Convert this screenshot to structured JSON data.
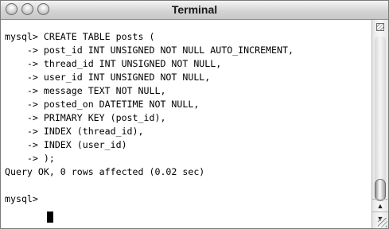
{
  "window": {
    "title": "Terminal"
  },
  "terminal": {
    "lines": [
      "mysql> CREATE TABLE posts (",
      "    -> post_id INT UNSIGNED NOT NULL AUTO_INCREMENT,",
      "    -> thread_id INT UNSIGNED NOT NULL,",
      "    -> user_id INT UNSIGNED NOT NULL,",
      "    -> message TEXT NOT NULL,",
      "    -> posted_on DATETIME NOT NULL,",
      "    -> PRIMARY KEY (post_id),",
      "    -> INDEX (thread_id),",
      "    -> INDEX (user_id)",
      "    -> );",
      "Query OK, 0 rows affected (0.02 sec)",
      "",
      "mysql> "
    ]
  },
  "icons": {
    "close": "close-icon",
    "minimize": "minimize-icon",
    "zoom": "zoom-icon",
    "split_pane": "split-pane-icon",
    "scroll_up": "arrow-up-icon",
    "scroll_down": "arrow-down-icon",
    "resize": "resize-grip-icon"
  }
}
